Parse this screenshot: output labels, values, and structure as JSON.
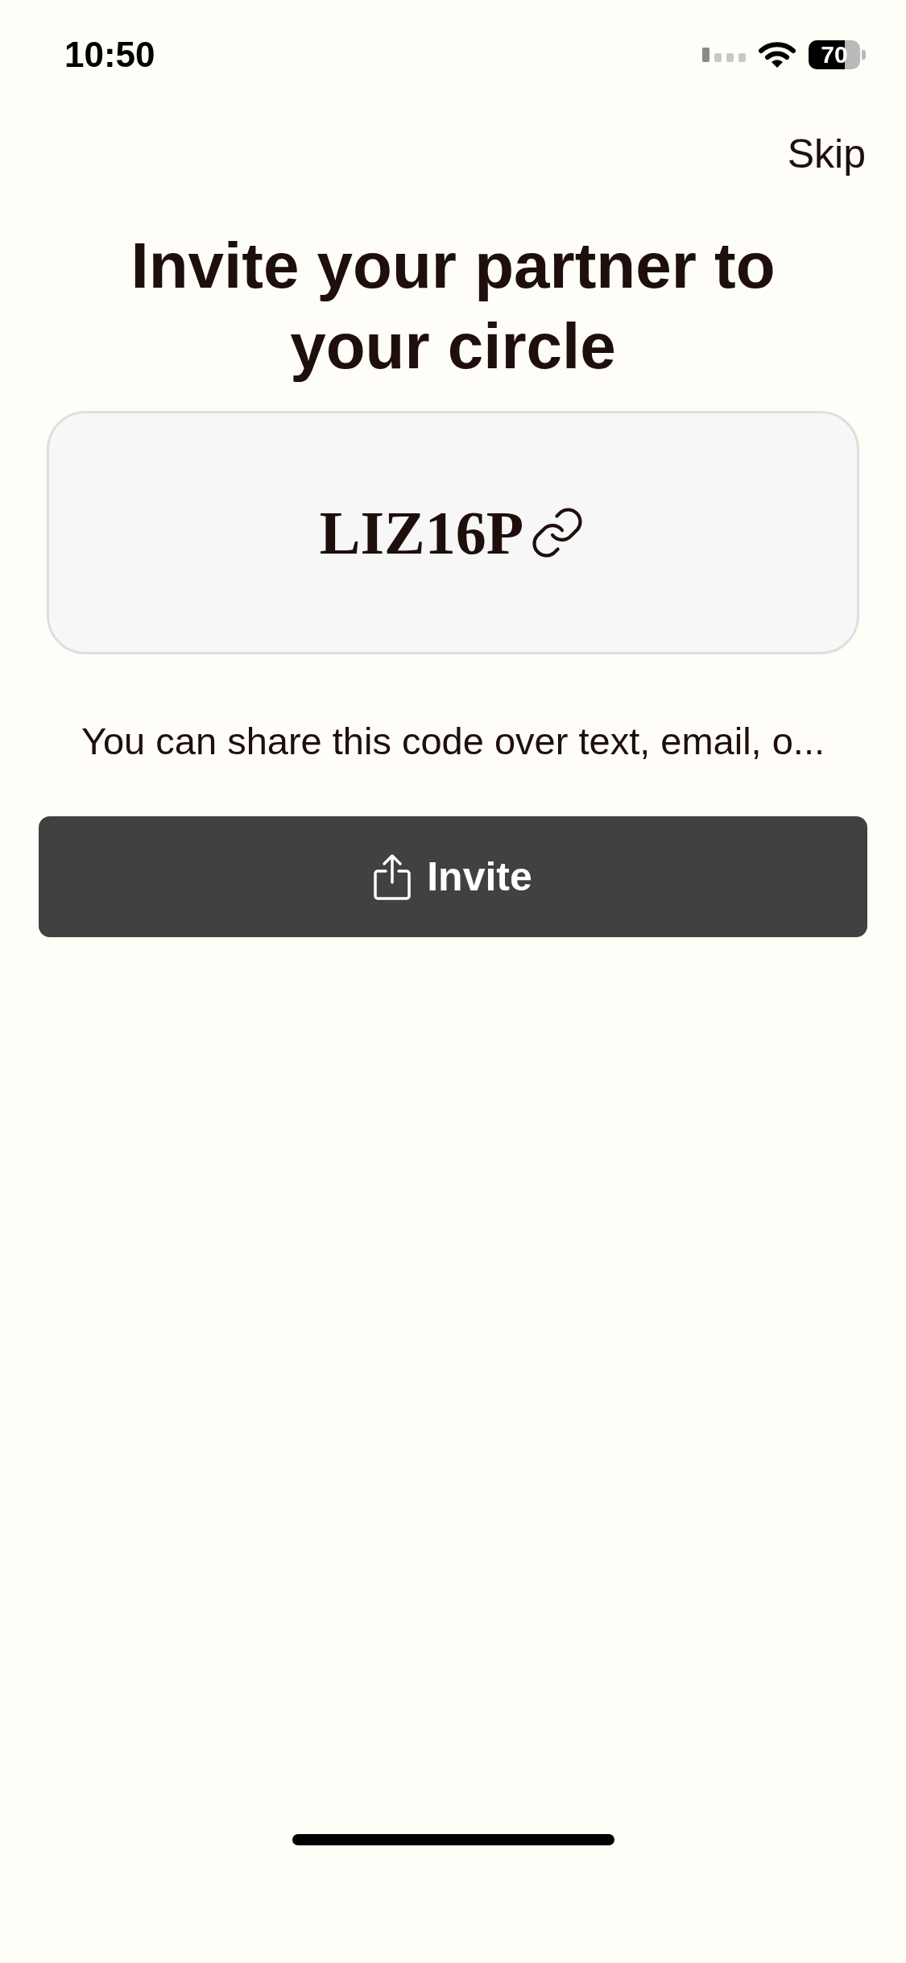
{
  "status_bar": {
    "time": "10:50",
    "battery": "70"
  },
  "skip": "Skip",
  "title": "Invite your partner to your circle",
  "code": "LIZ16P",
  "description": "You can share this code over text, email, o...",
  "invite_button": "Invite"
}
